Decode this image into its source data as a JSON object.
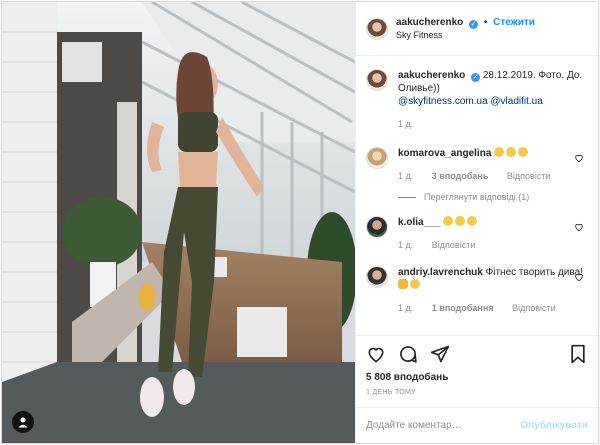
{
  "post": {
    "author": {
      "username": "aakucherenko",
      "follow_label": "Стежити",
      "location": "Sky Fitness"
    },
    "caption": {
      "username": "aakucherenko",
      "text": "28.12.2019. Фото. До. Оливье))",
      "mentions": [
        "@skyfitness.com.ua",
        "@vladifit.ua"
      ],
      "age": "1 д."
    },
    "comments": [
      {
        "username": "komarova_angelina",
        "text": "",
        "emoji_count": 3,
        "age": "1 д.",
        "likes": "3 вподобань",
        "reply": "Відповісти",
        "view_replies": "Переглянути відповіді (1)"
      },
      {
        "username": "k.olia___",
        "text": "",
        "emoji_count": 3,
        "age": "1 д.",
        "likes": "",
        "reply": "Відповісти"
      },
      {
        "username": "andriy.lavrenchuk",
        "text": "Фітнес творить дива!",
        "emoji_count": 2,
        "age": "1 д.",
        "likes": "1 вподобання",
        "reply": "Відповісти"
      }
    ],
    "likes_count": "5 808 вподобань",
    "posted_ago": "1 ДЕНЬ ТОМУ",
    "comment_placeholder": "Додайте коментар…",
    "publish_label": "Опублікувати"
  },
  "icons": {
    "verified": "verified-badge",
    "like": "heart-icon",
    "comment": "comment-icon",
    "share": "share-icon",
    "save": "bookmark-icon",
    "tag": "user-tag-icon"
  },
  "colors": {
    "accent": "#0095f6",
    "verified": "#3897f0",
    "muted": "#8e8e8e",
    "publish_disabled": "#b2dffc"
  }
}
